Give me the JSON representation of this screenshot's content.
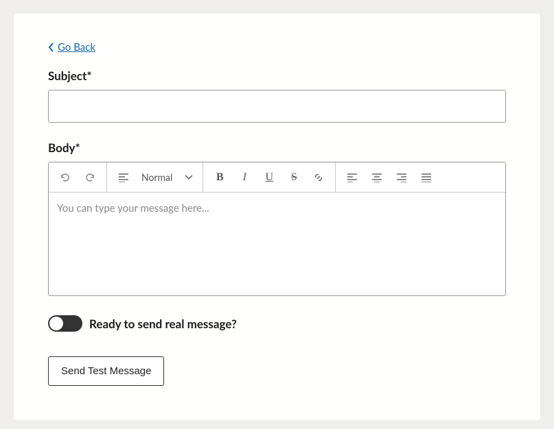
{
  "nav": {
    "go_back": "Go Back"
  },
  "form": {
    "subject_label": "Subject*",
    "subject_value": "",
    "body_label": "Body*",
    "body_placeholder": "You can type your message here...",
    "toggle_label": "Ready to send real message?",
    "toggle_on": false,
    "submit_label": "Send Test Message"
  },
  "toolbar": {
    "format_select": "Normal"
  }
}
